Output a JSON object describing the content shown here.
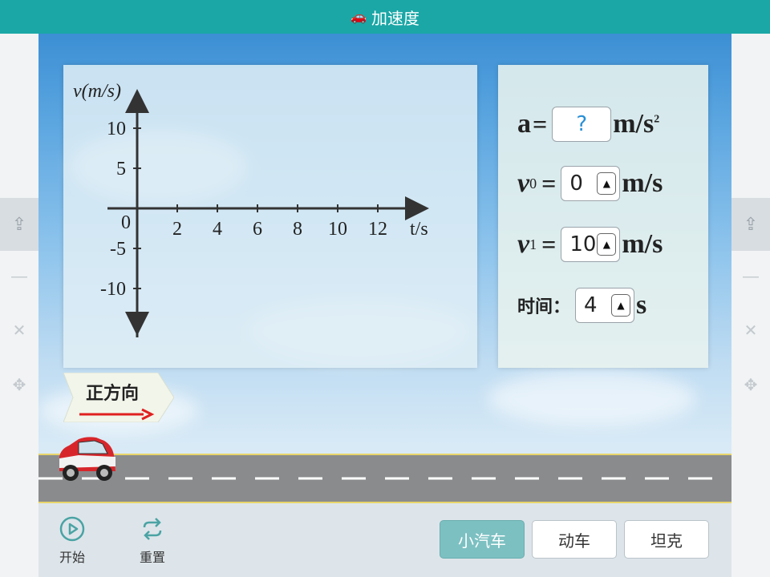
{
  "app": {
    "title": "加速度"
  },
  "graph": {
    "ylabel": "v(m/s)",
    "xlabel": "t/s",
    "origin": "0",
    "yticks": [
      "10",
      "5",
      "-5",
      "-10"
    ],
    "xticks": [
      "2",
      "4",
      "6",
      "8",
      "10",
      "12"
    ]
  },
  "params": {
    "a_label": "a",
    "a_value": "?",
    "a_unit": "m/s",
    "a_unit_exp": "2",
    "v0_symbol": "v",
    "v0_sub": "0",
    "v0_value": "0",
    "v0_unit": "m/s",
    "v1_symbol": "v",
    "v1_sub": "1",
    "v1_value": "10",
    "v1_unit": "m/s",
    "time_label": "时间：",
    "time_value": "4",
    "time_unit": "s",
    "equals": "="
  },
  "direction": {
    "label": "正方向"
  },
  "controls": {
    "start_label": "开始",
    "reset_label": "重置"
  },
  "vehicles": [
    {
      "label": "小汽车",
      "active": true
    },
    {
      "label": "动车",
      "active": false
    },
    {
      "label": "坦克",
      "active": false
    }
  ],
  "colors": {
    "titlebar": "#1aa7a6",
    "accent_active": "#7cc0c2",
    "arrow": "#e02020",
    "car": "#d7262b"
  },
  "icons": {
    "title": "car-icon",
    "start": "play-icon",
    "reset": "repeat-icon",
    "share": "share-icon"
  }
}
